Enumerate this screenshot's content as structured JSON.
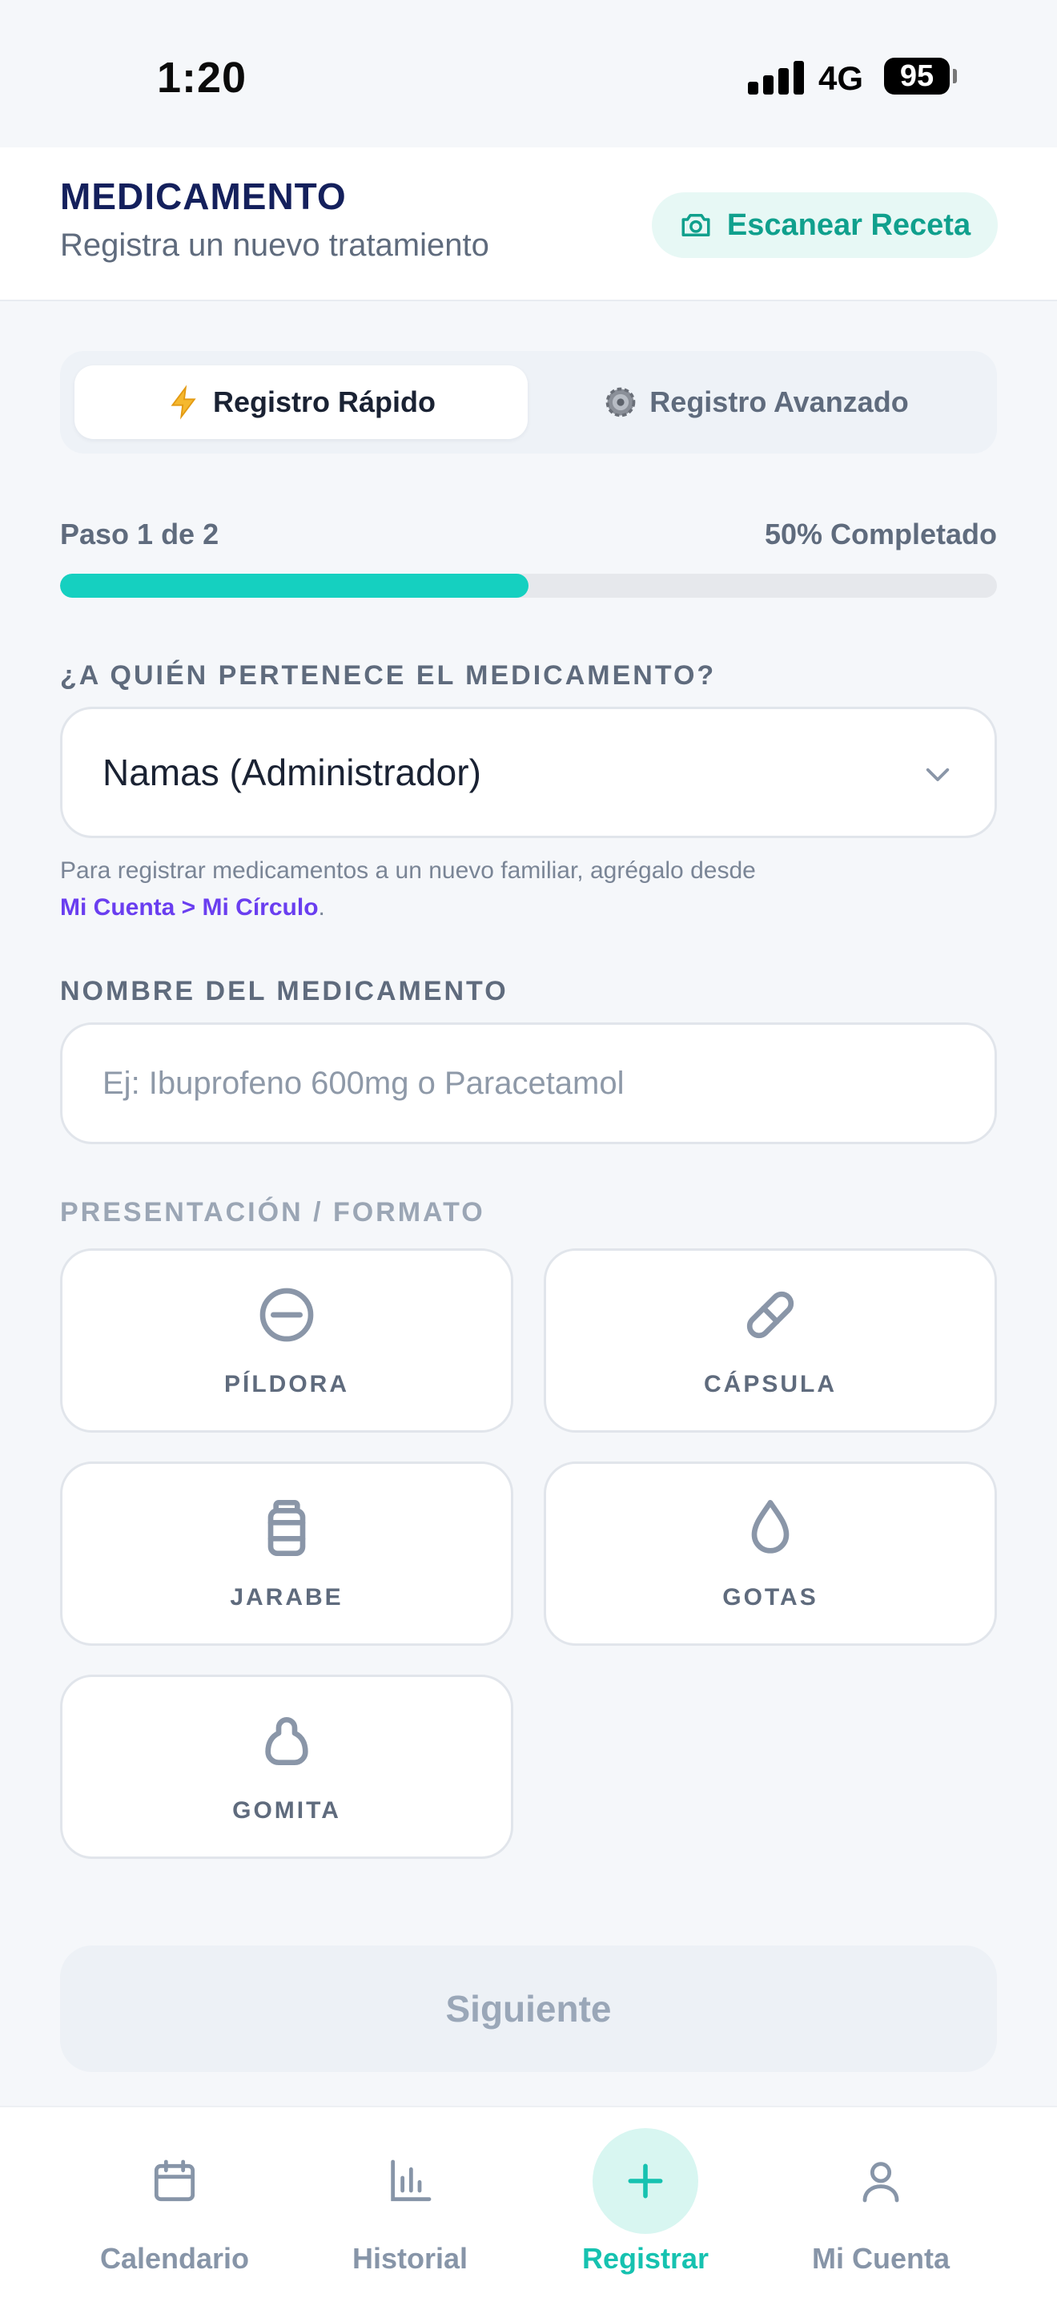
{
  "status_bar": {
    "time": "1:20",
    "network": "4G",
    "battery": "95"
  },
  "header": {
    "title": "MEDICAMENTO",
    "subtitle": "Registra un nuevo tratamiento",
    "scan_label": "Escanear Receta"
  },
  "mode_tabs": [
    {
      "label": "Registro Rápido",
      "icon": "lightning-icon",
      "active": true
    },
    {
      "label": "Registro Avanzado",
      "icon": "gear-icon",
      "active": false
    }
  ],
  "progress": {
    "step": "Paso 1 de 2",
    "completed": "50% Completado",
    "percent": 50
  },
  "owner": {
    "label": "¿A QUIÉN PERTENECE EL MEDICAMENTO?",
    "selected": "Namas (Administrador)",
    "help_prefix": "Para registrar medicamentos a un nuevo familiar, agrégalo desde",
    "help_link": "Mi Cuenta > Mi Círculo",
    "help_suffix": "."
  },
  "medication_name": {
    "label": "NOMBRE DEL MEDICAMENTO",
    "value": "",
    "placeholder": "Ej: Ibuprofeno 600mg o Paracetamol"
  },
  "format": {
    "label": "PRESENTACIÓN / FORMATO",
    "options": [
      {
        "label": "PÍLDORA",
        "icon": "pill-icon"
      },
      {
        "label": "CÁPSULA",
        "icon": "capsule-icon"
      },
      {
        "label": "JARABE",
        "icon": "syrup-bottle-icon"
      },
      {
        "label": "GOTAS",
        "icon": "drop-icon"
      },
      {
        "label": "GOMITA",
        "icon": "gummy-icon"
      }
    ]
  },
  "next_button": {
    "label": "Siguiente",
    "enabled": false
  },
  "bottom_nav": [
    {
      "label": "Calendario",
      "icon": "calendar-icon",
      "active": false
    },
    {
      "label": "Historial",
      "icon": "bar-chart-icon",
      "active": false
    },
    {
      "label": "Registrar",
      "icon": "plus-icon",
      "active": true
    },
    {
      "label": "Mi Cuenta",
      "icon": "user-icon",
      "active": false
    }
  ],
  "colors": {
    "accent": "#15d0c0",
    "accent_text": "#10a08d",
    "title": "#14205c",
    "link": "#6a3ef0",
    "muted": "#5f6b7d"
  }
}
